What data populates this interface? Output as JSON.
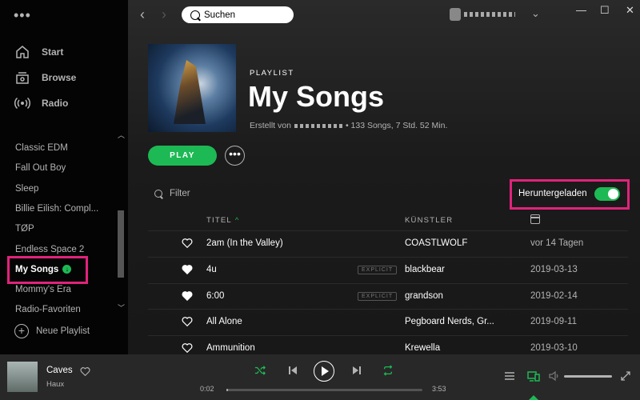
{
  "window": {
    "minimize": "—",
    "maximize": "☐",
    "close": "✕"
  },
  "sidebar": {
    "menu_dots": "•••",
    "nav": [
      {
        "label": "Start",
        "icon": "home-icon"
      },
      {
        "label": "Browse",
        "icon": "browse-icon"
      },
      {
        "label": "Radio",
        "icon": "radio-icon"
      }
    ],
    "playlists": [
      {
        "label": "Classic EDM"
      },
      {
        "label": "Fall Out Boy"
      },
      {
        "label": "Sleep"
      },
      {
        "label": "Billie Eilish: Compl..."
      },
      {
        "label": "TØP"
      },
      {
        "label": "Endless Space 2"
      },
      {
        "label": "My Songs",
        "active": true,
        "downloaded": true
      },
      {
        "label": "Mommy's Era"
      },
      {
        "label": "Radio-Favoriten"
      }
    ],
    "new_playlist_label": "Neue Playlist",
    "new_playlist_icon": "+"
  },
  "topbar": {
    "back_icon": "‹",
    "forward_icon": "›",
    "search_label": "Suchen",
    "user_menu_icon": "⌄"
  },
  "playlist": {
    "type_label": "PLAYLIST",
    "title": "My Songs",
    "created_by_label": "Erstellt von",
    "stats": "• 133 Songs, 7 Std. 52 Min.",
    "play_label": "PLAY",
    "more_label": "•••",
    "filter_placeholder": "Filter",
    "downloaded_label": "Heruntergeladen",
    "downloaded_on": true
  },
  "table": {
    "col_title": "TITEL",
    "sort_icon": "^",
    "col_artist": "KÜNSTLER",
    "col_date_icon": "calendar-icon",
    "explicit_label": "EXPLICIT",
    "rows": [
      {
        "title": "2am (In the Valley)",
        "artist": "COASTLWOLF",
        "date": "vor 14 Tagen",
        "liked": false,
        "explicit": false
      },
      {
        "title": "4u",
        "artist": "blackbear",
        "date": "2019-03-13",
        "liked": true,
        "explicit": true
      },
      {
        "title": "6:00",
        "artist": "grandson",
        "date": "2019-02-14",
        "liked": true,
        "explicit": true
      },
      {
        "title": "All Alone",
        "artist": "Pegboard Nerds, Gr...",
        "date": "2019-09-11",
        "liked": false,
        "explicit": false
      },
      {
        "title": "Ammunition",
        "artist": "Krewella",
        "date": "2019-03-10",
        "liked": false,
        "explicit": false
      }
    ]
  },
  "player": {
    "track_title": "Caves",
    "track_artist": "Haux",
    "elapsed": "0:02",
    "duration": "3:53",
    "progress_fraction": 0.01,
    "volume_fraction": 0.75,
    "accent_color": "#1db954"
  },
  "colors": {
    "accent": "#1db954",
    "highlight": "#e0237b",
    "sidebar_bg": "#040404"
  }
}
